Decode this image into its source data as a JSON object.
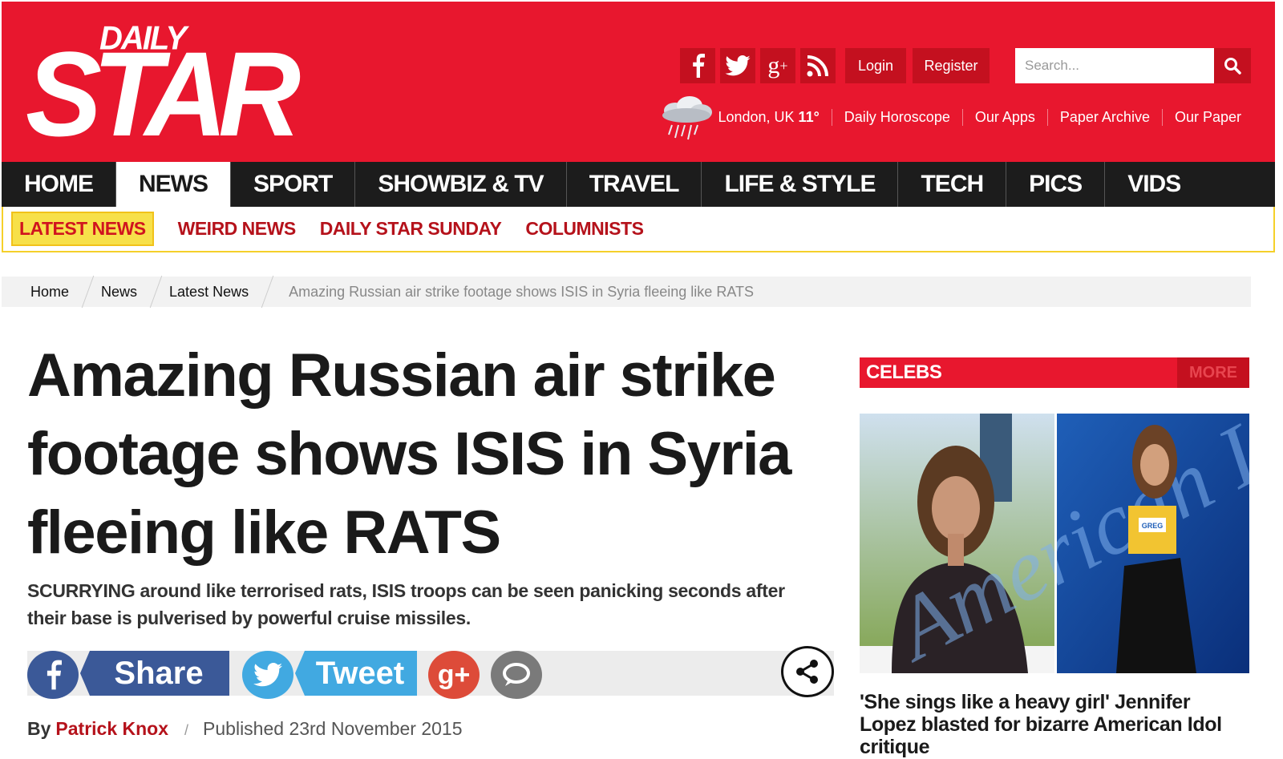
{
  "header": {
    "logo_daily": "DAILY",
    "logo_star": "STAR",
    "login": "Login",
    "register": "Register",
    "search_placeholder": "Search...",
    "weather_location": "London, UK",
    "weather_temp": "11°",
    "links": [
      "Daily Horoscope",
      "Our Apps",
      "Paper Archive",
      "Our Paper"
    ],
    "social_icons": [
      "facebook-icon",
      "twitter-icon",
      "google-plus-icon",
      "rss-icon"
    ],
    "brand_color": "#e8172e",
    "dark_red": "#c4101f"
  },
  "mainnav": {
    "items": [
      "HOME",
      "NEWS",
      "SPORT",
      "SHOWBIZ & TV",
      "TRAVEL",
      "LIFE & STYLE",
      "TECH",
      "PICS",
      "VIDS"
    ],
    "active": "NEWS"
  },
  "subnav": {
    "items": [
      "LATEST NEWS",
      "WEIRD NEWS",
      "DAILY STAR SUNDAY",
      "COLUMNISTS"
    ],
    "active": "LATEST NEWS"
  },
  "breadcrumb": {
    "items": [
      "Home",
      "News",
      "Latest News"
    ],
    "current": "Amazing Russian air strike footage shows ISIS in Syria fleeing like RATS"
  },
  "article": {
    "headline": "Amazing Russian air strike footage shows ISIS in Syria fleeing like RATS",
    "standfirst": "SCURRYING around like terrorised rats, ISIS troops can be seen panicking seconds after their base is pulverised by powerful cruise missiles.",
    "share": {
      "facebook_label": "Share",
      "twitter_label": "Tweet",
      "google_label": "g+"
    },
    "byline_prefix": "By",
    "author": "Patrick Knox",
    "byline_sep": "/",
    "published": "Published 23rd November 2015"
  },
  "sidebar": {
    "section_title": "CELEBS",
    "more_label": "MORE",
    "image_text": "American Idol",
    "badge_text": "GREG",
    "caption": "'She sings like a heavy girl' Jennifer Lopez blasted for bizarre American Idol critique"
  }
}
